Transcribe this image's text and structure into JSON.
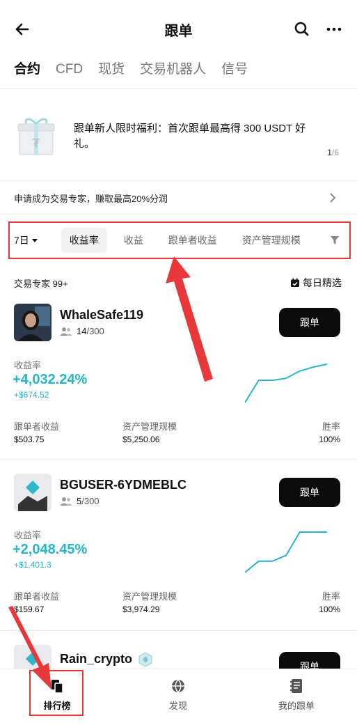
{
  "header": {
    "title": "跟单",
    "back_icon": "back-arrow-icon",
    "search_icon": "search-icon",
    "more_icon": "more-icon"
  },
  "tabs": [
    {
      "label": "合约",
      "active": true
    },
    {
      "label": "CFD"
    },
    {
      "label": "现货"
    },
    {
      "label": "交易机器人"
    },
    {
      "label": "信号"
    }
  ],
  "banner": {
    "text": "跟单新人限时福利：首次跟单最高得 300 USDT 好礼。",
    "page_current": "1",
    "page_total": "/6"
  },
  "apply": {
    "text": "申请成为交易专家，赚取最高20%分润"
  },
  "filters": {
    "period": "7日",
    "chips": [
      "收益率",
      "收益",
      "跟单者收益",
      "资产管理规模"
    ]
  },
  "list": {
    "count_label": "交易专家 99+",
    "daily_label": "每日精选"
  },
  "traders": [
    {
      "name": "WhaleSafe119",
      "followers": "14",
      "followers_max": "/300",
      "button": "跟单",
      "roi_label": "收益率",
      "roi": "+4,032.24%",
      "pnl": "+$674.52",
      "stats": [
        {
          "label": "跟单者收益",
          "value": "$503.75"
        },
        {
          "label": "资产管理规模",
          "value": "$5,250.06"
        },
        {
          "label": "胜率",
          "value": "100%"
        }
      ],
      "spark": [
        0,
        0.55,
        0.55,
        0.6,
        0.78,
        0.88,
        0.95
      ]
    },
    {
      "name": "BGUSER-6YDMEBLC",
      "followers": "5",
      "followers_max": "/300",
      "button": "跟单",
      "roi_label": "收益率",
      "roi": "+2,048.45%",
      "pnl": "+$1,401.3",
      "stats": [
        {
          "label": "跟单者收益",
          "value": "$159.67"
        },
        {
          "label": "资产管理规模",
          "value": "$3,974.29"
        },
        {
          "label": "胜率",
          "value": "100%"
        }
      ],
      "spark": [
        0,
        0.28,
        0.28,
        0.42,
        1,
        1,
        1
      ]
    },
    {
      "name": "Rain_crypto",
      "button": "跟单"
    }
  ],
  "bottom_nav": [
    {
      "label": "排行榜",
      "icon": "leaderboard-icon",
      "active": true
    },
    {
      "label": "发现",
      "icon": "globe-icon"
    },
    {
      "label": "我的跟单",
      "icon": "notebook-icon"
    }
  ],
  "colors": {
    "accent": "#27b5c8",
    "highlight": "#e8383a"
  }
}
